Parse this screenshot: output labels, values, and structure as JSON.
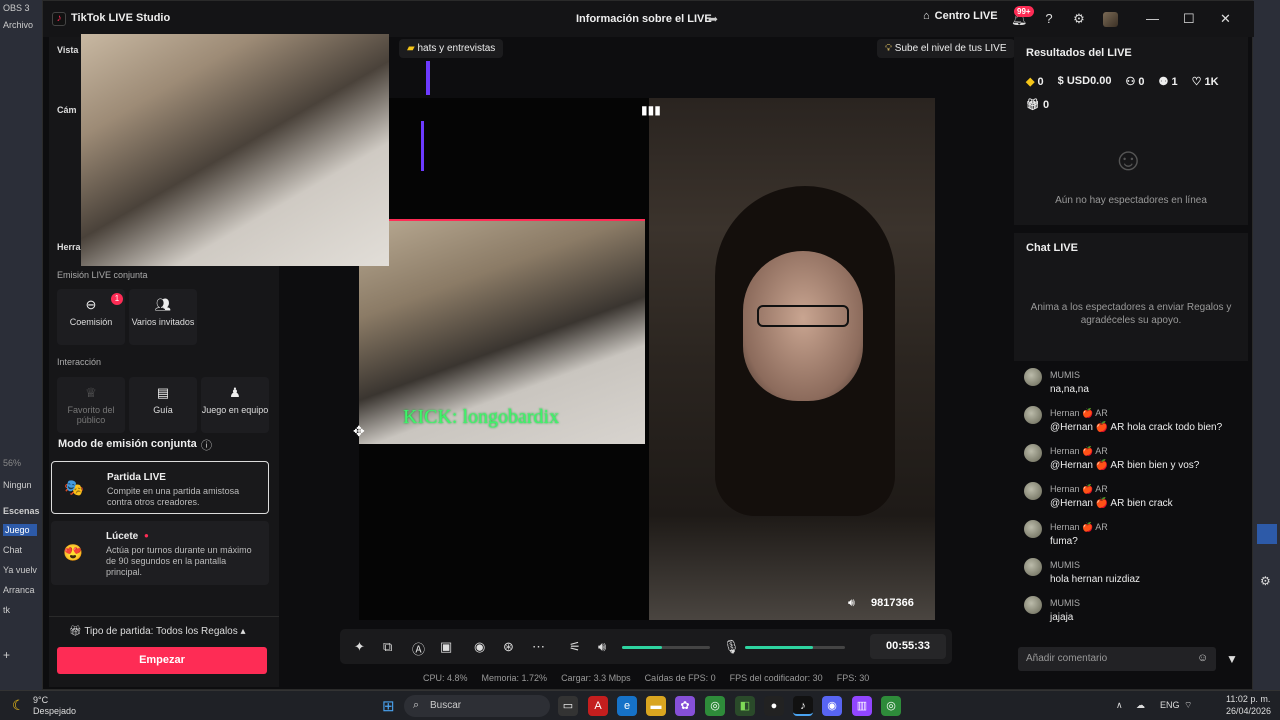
{
  "obs": {
    "title": "OBS 3",
    "menu": "Archivo",
    "zoom": "56%",
    "ninguna": "Ningun",
    "escenas": "Escenas",
    "scenes": [
      "Juego",
      "Chat",
      "Ya vuelv",
      "Arranca",
      "tk"
    ]
  },
  "window": {
    "app_title": "TikTok LIVE Studio",
    "center_title": "Información sobre el LIVE",
    "centro": "Centro LIVE",
    "notif_badge": "99+"
  },
  "left": {
    "vista": "Vista",
    "camara": "Cám",
    "herramientas": "Herra",
    "emision_conjunta": "Emisión LIVE conjunta",
    "coemision": "Coemisión",
    "coemision_badge": "1",
    "varios": "Varios invitados",
    "interaccion": "Interacción",
    "favorito": "Favorito del público",
    "guia": "Guía",
    "juego": "Juego en equipo",
    "mode_title": "Modo de emisión conjunta",
    "card1_title": "Partida LIVE",
    "card1_desc": "Compite en una partida amistosa contra otros creadores.",
    "card2_title": "Lúcete",
    "card2_desc": "Actúa por turnos durante un máximo de 90 segundos en la pantalla principal.",
    "tipo": "Tipo de partida: Todos los Regalos",
    "start": "Empezar"
  },
  "center": {
    "pill_chats": "hats y entrevistas",
    "pill_nivel": "Sube el nivel de tus LIVE",
    "kick": "KICK: longobardix",
    "counter": "9817366",
    "timer": "00:55:33"
  },
  "stats": {
    "cpu": "CPU: 4.8%",
    "mem": "Memoria: 1.72%",
    "carga": "Cargar: 3.3 Mbps",
    "fps_drop": "Caídas de FPS: 0",
    "enc": "FPS del codificador: 30",
    "fps": "FPS: 30"
  },
  "results": {
    "title": "Resultados del LIVE",
    "diamonds": "0",
    "usd": "USD0.00",
    "viewers": "0",
    "followers": "1",
    "likes": "1K",
    "gifts": "0",
    "empty": "Aún no hay espectadores en línea"
  },
  "chat": {
    "title": "Chat LIVE",
    "prompt": "Anima a los espectadores a enviar Regalos y agradéceles su apoyo.",
    "messages": [
      {
        "name": "MUMIS",
        "text": "na,na,na"
      },
      {
        "name": "Hernan 🍎 AR",
        "text": "@Hernan 🍎 AR hola crack todo bien?"
      },
      {
        "name": "Hernan 🍎 AR",
        "text": "@Hernan 🍎 AR bien bien y vos?"
      },
      {
        "name": "Hernan 🍎 AR",
        "text": "@Hernan 🍎 AR bien crack"
      },
      {
        "name": "Hernan 🍎 AR",
        "text": "fuma?"
      },
      {
        "name": "MUMIS",
        "text": "hola hernan ruizdiaz"
      },
      {
        "name": "MUMIS",
        "text": "jajaja"
      }
    ],
    "comment_placeholder": "Añadir comentario"
  },
  "taskbar": {
    "temp": "9°C",
    "weather": "Despejado",
    "search": "Buscar",
    "lang": "ENG",
    "time": "11:02 p. m.",
    "date": "26/04/2026"
  },
  "colors": {
    "accent": "#fe2c55",
    "slider": "#2ed4a0"
  }
}
